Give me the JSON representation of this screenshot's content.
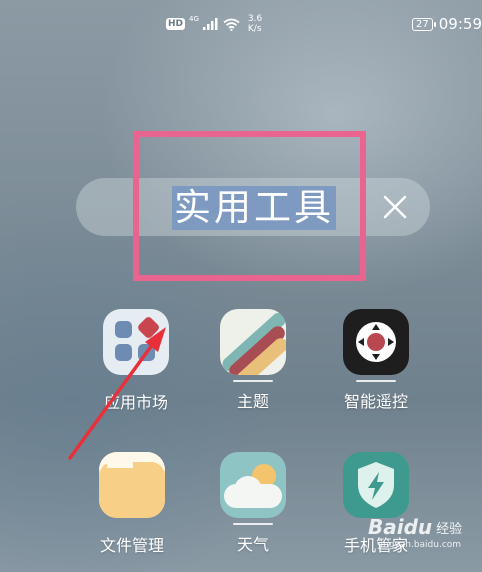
{
  "status_bar": {
    "hd": "HD",
    "network_type": "4G",
    "speed_value": "3.6",
    "speed_unit": "K/s",
    "battery": "27",
    "time": "09:59"
  },
  "folder": {
    "name": "实用工具",
    "close_icon": "close-icon"
  },
  "apps": [
    {
      "label": "应用市场",
      "icon": "app-market-icon"
    },
    {
      "label": "主题",
      "icon": "themes-icon"
    },
    {
      "label": "智能遥控",
      "icon": "smart-remote-icon"
    },
    {
      "label": "文件管理",
      "icon": "file-manager-icon"
    },
    {
      "label": "天气",
      "icon": "weather-icon"
    },
    {
      "label": "手机管家",
      "icon": "phone-manager-icon"
    }
  ],
  "annotation": {
    "highlight_color": "#e9658f",
    "arrow_color": "#e8303a"
  },
  "watermark": {
    "brand": "Baidu",
    "text": "经验",
    "url": "jingyan.baidu.com"
  }
}
